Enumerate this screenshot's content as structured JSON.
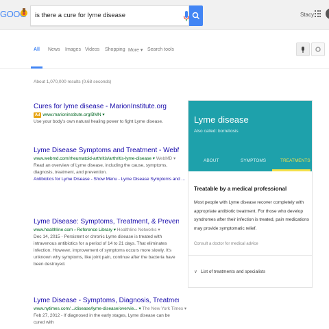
{
  "header": {
    "logo_text": "GOOG",
    "query": "is there a cure for lyme disease",
    "user_name": "Stacy"
  },
  "tabs": [
    {
      "label": "All"
    },
    {
      "label": "News"
    },
    {
      "label": "Images"
    },
    {
      "label": "Videos"
    },
    {
      "label": "Shopping"
    },
    {
      "label": "More ▾"
    },
    {
      "label": "Search tools"
    }
  ],
  "stats": "About 1,070,000 results (0.68 seconds)",
  "results": [
    {
      "title": "Cures for lyme disease - MarionInstitute.org",
      "ad_badge": "Ad",
      "url": "www.marioninstitute.org/BMN ▾",
      "snippet": "Use your body's own natural healing power to fight Lyme disease."
    },
    {
      "title": "Lyme Disease Symptoms and Treatment - WebMD",
      "url": "www.webmd.com/rheumatoid-arthritis/arthritis-lyme-disease ▾",
      "url_extra": " WebMD ▾",
      "snippet": "Read an overview of Lyme disease, including the cause, symptoms, diagnosis, treatment, and prevention.",
      "sublinks": "Antibiotics for Lyme Disease - Show Menu - Lyme Disease Symptoms and ..."
    },
    {
      "title": "Lyme Disease: Symptoms, Treatment, & Prevention",
      "url": "www.healthline.com › Reference Library ▾",
      "url_extra": " Healthline Networks ▾",
      "snippet": "Dec 14, 2015 - Persistent or chronic Lyme disease is treated with intravenous antibiotics for a period of 14 to 21 days. That eliminates infection. However, improvement of symptoms occurs more slowly. It's unknown why symptoms, like joint pain, continue after the bacteria have been destroyed."
    },
    {
      "title": "Lyme Disease - Symptoms, Diagnosis, Treatment of Lyme ...",
      "url": "www.nytimes.com/.../disease/lyme-disease/overvie... ▾",
      "url_extra": " The New York Times ▾",
      "snippet": "Feb 27, 2012 - If diagnosed in the early stages, Lyme disease can be cured with"
    }
  ],
  "knowledge_panel": {
    "title": "Lyme disease",
    "subtitle": "Also called: borreliosis",
    "tabs": [
      "ABOUT",
      "SYMPTOMS",
      "TREATMENTS"
    ],
    "heading": "Treatable by a medical professional",
    "text": "Most people with Lyme disease recover completely with appropriate antibiotic treatment. For those who develop syndromes after their infection is treated, pain medications may provide symptomatic relief.",
    "note": "Consult a doctor for medical advice",
    "list_item": "List of treatments and specialists",
    "accent_color": "#1ea1ab",
    "active_tab_color": "#f5e14a"
  },
  "colors": {
    "link": "#1a0dab",
    "url": "#006621",
    "brand_blue": "#4285f4"
  },
  "icons": [
    "doodle-icon",
    "microphone-icon",
    "search-icon",
    "apps-grid-icon",
    "avatar-icon",
    "mic-tool-icon",
    "settings-icon",
    "chevron-down-icon"
  ]
}
